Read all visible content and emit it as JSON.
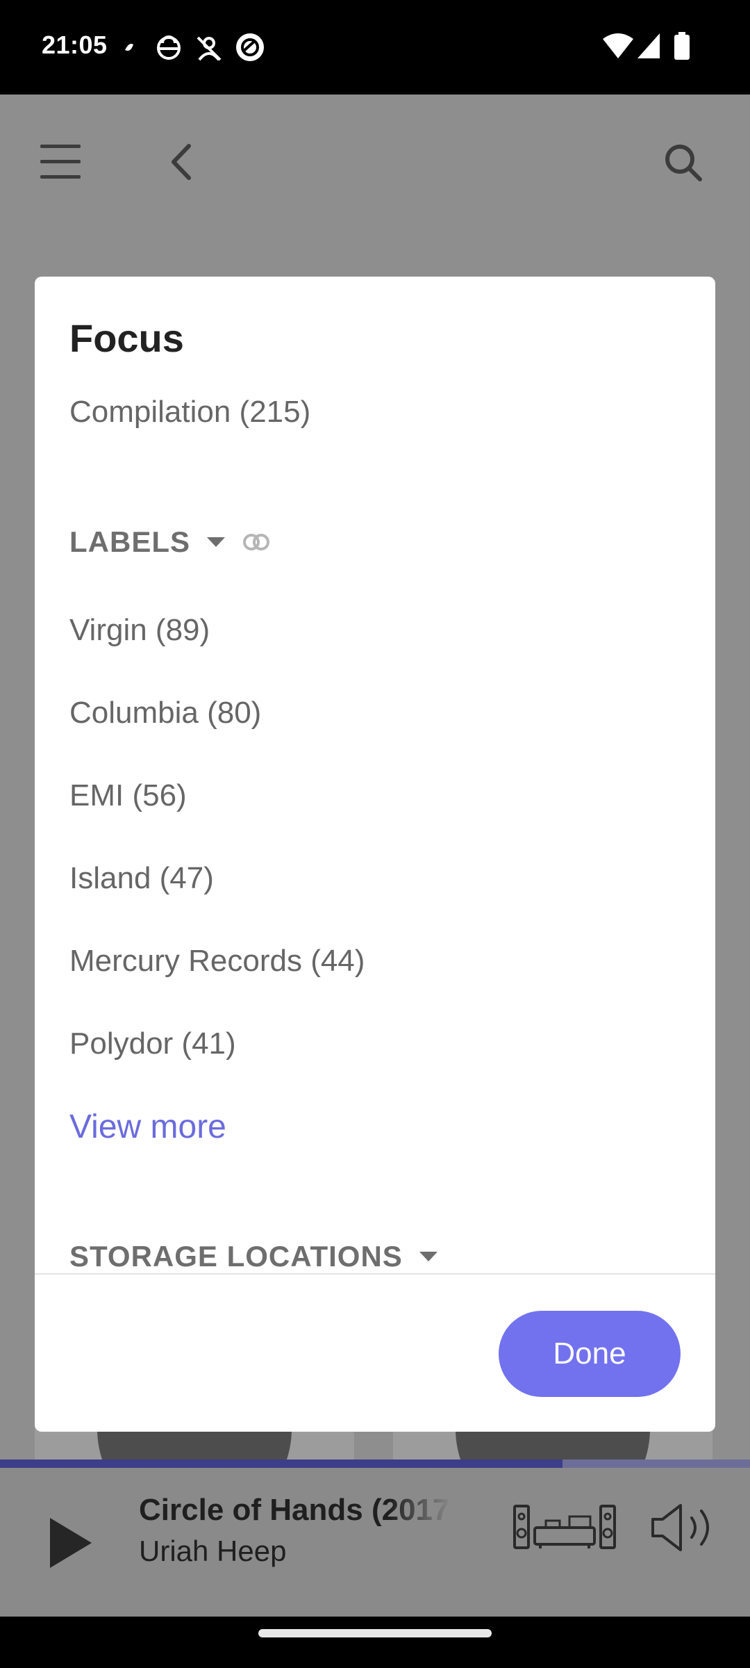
{
  "status_bar": {
    "time": "21:05",
    "icons_left": [
      "dot-icon",
      "cloud-sync-icon",
      "no-person-icon",
      "app-circle-icon"
    ],
    "icons_right": [
      "wifi-icon",
      "cell-signal-icon",
      "battery-icon"
    ]
  },
  "topbar": {
    "icons": [
      "menu-icon",
      "back-icon",
      "search-icon"
    ]
  },
  "dialog": {
    "title": "Focus",
    "items_top": [
      "Compilation (215)"
    ],
    "labels_section": {
      "heading": "LABELS",
      "items": [
        "Virgin (89)",
        "Columbia (80)",
        "EMI (56)",
        "Island (47)",
        "Mercury Records (44)",
        "Polydor (41)"
      ],
      "view_more": "View more"
    },
    "storage_section": {
      "heading": "STORAGE LOCATIONS"
    },
    "done_label": "Done"
  },
  "player": {
    "track": "Circle of Hands (2017",
    "artist": "Uriah Heep",
    "progress": 0.75,
    "colors": {
      "accent": "#7272ee"
    }
  }
}
